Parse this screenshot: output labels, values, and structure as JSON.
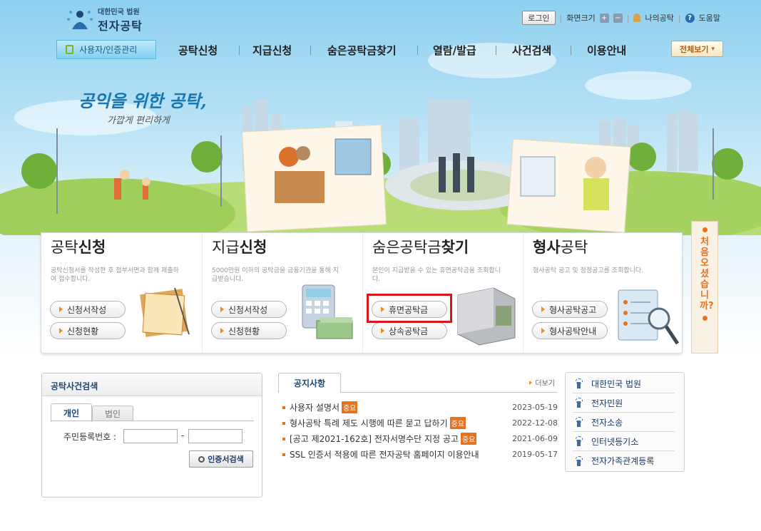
{
  "header": {
    "logo_top": "대한민국 법원",
    "logo_name": "전자공탁",
    "util": {
      "login": "로그인",
      "font_size": "화면크기",
      "plus": "+",
      "minus": "−",
      "my": "나의공탁",
      "help": "도움말"
    }
  },
  "nav": {
    "user_mgmt": "사용자/인증관리",
    "items": [
      "공탁신청",
      "지급신청",
      "숨은공탁금찾기",
      "열람/발급",
      "사건검색",
      "이용안내"
    ],
    "all_view": "전체보기"
  },
  "hero": {
    "slogan_main": "공익을 위한 공탁,",
    "slogan_sub": "가깝게 편리하게"
  },
  "side_banner": {
    "text": "처음오셨습니까?"
  },
  "cards": [
    {
      "title_light": "공탁",
      "title_bold": "신청",
      "desc": "공탁신청서를 작성한 후 첨부서면과 함께 제출하여 접수합니다.",
      "buttons": [
        "신청서작성",
        "신청현황"
      ]
    },
    {
      "title_light": "지급",
      "title_bold": "신청",
      "desc": "5000만원 이하의 공탁금을 금융기관을 통해 지급받습니다.",
      "buttons": [
        "신청서작성",
        "신청현황"
      ]
    },
    {
      "title_light": "숨은공탁금",
      "title_bold": "찾기",
      "desc": "본인이 지급받을 수 있는 휴면공탁금을 조회합니다.",
      "buttons": [
        "휴면공탁금",
        "상속공탁금"
      ]
    },
    {
      "title_light": "공탁",
      "title_bold": "형사",
      "desc": "형사공탁 공고 및 정정공고를 조회합니다.",
      "buttons": [
        "형사공탁공고",
        "형사공탁안내"
      ]
    }
  ],
  "case_search": {
    "title": "공탁사건검색",
    "tab_person": "개인",
    "tab_corp": "법인",
    "rrn_label": "주민등록번호 :",
    "dash": "-",
    "cert_search": "인증서검색"
  },
  "notice": {
    "tab": "공지사항",
    "more": "더보기",
    "important": "중요",
    "items": [
      {
        "title": "사용자 설명서",
        "important": true,
        "date": "2023-05-19"
      },
      {
        "title": "형사공탁 특례 제도 시행에 따른 묻고 답하기",
        "important": true,
        "date": "2022-12-08"
      },
      {
        "title": "[공고 제2021-162호] 전자서명수단 지정 공고",
        "important": true,
        "date": "2021-06-09"
      },
      {
        "title": "SSL 인증서 적용에 따른 전자공탁 홈페이지 이용안내",
        "important": false,
        "date": "2019-05-17"
      }
    ]
  },
  "quick_links": [
    "대한민국 법원",
    "전자민원",
    "전자소송",
    "인터넷등기소",
    "전자가족관계등록"
  ],
  "colors": {
    "accent": "#e8721c",
    "highlight": "#d9161b",
    "navy": "#1d4677"
  }
}
